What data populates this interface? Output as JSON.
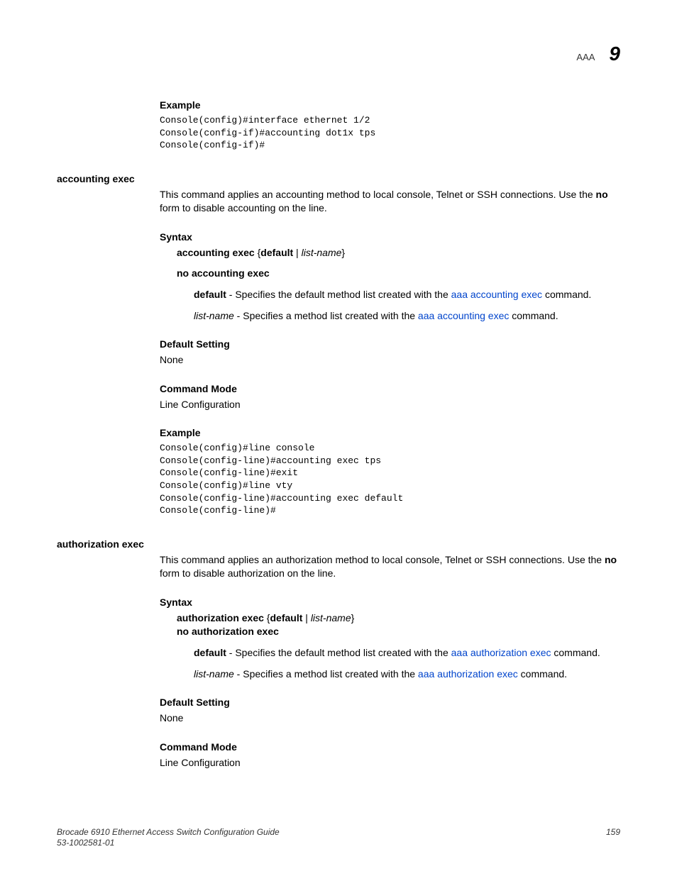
{
  "header": {
    "label": "AAA",
    "chapter": "9"
  },
  "sec_example1": {
    "title": "Example",
    "code": "Console(config)#interface ethernet 1/2\nConsole(config-if)#accounting dot1x tps\nConsole(config-if)#"
  },
  "cmd1": {
    "title": "accounting exec",
    "desc1": "This command applies an accounting method to local console, Telnet or SSH connections. Use the ",
    "desc_no": "no",
    "desc2": " form to disable accounting on the line.",
    "syntax_title": "Syntax",
    "syntax_line1_a": "accounting exec",
    "syntax_line1_b": " {",
    "syntax_line1_c": "default",
    "syntax_line1_d": " | ",
    "syntax_line1_e": "list-name",
    "syntax_line1_f": "}",
    "syntax_line2": "no accounting exec",
    "opt1_a": "default",
    "opt1_b": " - Specifies the default method list created with the ",
    "opt1_link": "aaa accounting exec",
    "opt1_c": " command.",
    "opt2_a": "list-name",
    "opt2_b": " - Specifies a method list created with the ",
    "opt2_link": "aaa accounting exec",
    "opt2_c": " command.",
    "default_title": "Default Setting",
    "default_val": "None",
    "mode_title": "Command Mode",
    "mode_val": "Line Configuration",
    "example_title": "Example",
    "example_code": "Console(config)#line console\nConsole(config-line)#accounting exec tps\nConsole(config-line)#exit\nConsole(config)#line vty\nConsole(config-line)#accounting exec default\nConsole(config-line)#"
  },
  "cmd2": {
    "title": "authorization exec",
    "desc1": "This command applies an authorization method to local console, Telnet or SSH connections. Use the ",
    "desc_no": "no",
    "desc2": " form to disable authorization on the line.",
    "syntax_title": "Syntax",
    "syntax_line1_a": "authorization exec",
    "syntax_line1_b": " {",
    "syntax_line1_c": "default",
    "syntax_line1_d": " | ",
    "syntax_line1_e": "list-name",
    "syntax_line1_f": "}",
    "syntax_line2": "no authorization exec",
    "opt1_a": "default",
    "opt1_b": " - Specifies the default method list created with the ",
    "opt1_link": "aaa authorization exec",
    "opt1_c": " command.",
    "opt2_a": "list-name",
    "opt2_b": " - Specifies a method list created with the ",
    "opt2_link": "aaa authorization exec",
    "opt2_c": " command.",
    "default_title": "Default Setting",
    "default_val": "None",
    "mode_title": "Command Mode",
    "mode_val": "Line Configuration"
  },
  "footer": {
    "title": "Brocade 6910 Ethernet Access Switch Configuration Guide",
    "docnum": "53-1002581-01",
    "page": "159"
  }
}
